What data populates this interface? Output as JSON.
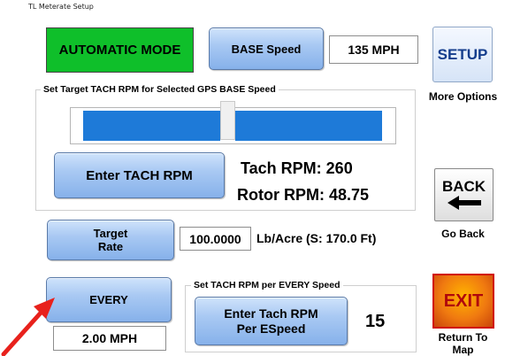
{
  "window": {
    "title": "TL Meterate Setup"
  },
  "mode": {
    "label": "AUTOMATIC MODE",
    "color": "#0fbf2a"
  },
  "base_speed": {
    "button_label": "BASE Speed",
    "value": "135 MPH"
  },
  "setup": {
    "button_label": "SETUP",
    "caption": "More Options"
  },
  "tach_group": {
    "label": "Set Target TACH RPM for Selected GPS BASE Speed",
    "enter_button": "Enter TACH RPM",
    "tach_rpm": "Tach  RPM: 260",
    "rotor_rpm": "Rotor RPM: 48.75",
    "bar_color": "#1e7ad8"
  },
  "back": {
    "button_label": "BACK",
    "caption": "Go Back"
  },
  "target_rate": {
    "button_label_line1": "Target",
    "button_label_line2": "Rate",
    "value": "100.0000",
    "unit_text": "Lb/Acre  (S: 170.0 Ft)"
  },
  "every": {
    "button_label": "EVERY",
    "value": "2.00 MPH"
  },
  "espeed_group": {
    "label": "Set TACH RPM per EVERY Speed",
    "button_line1": "Enter Tach RPM",
    "button_line2": "Per ESpeed",
    "value": "15"
  },
  "exit": {
    "button_label": "EXIT",
    "caption_line1": "Return To",
    "caption_line2": "Map"
  },
  "annotation": {
    "arrow_color": "#e8211c"
  }
}
